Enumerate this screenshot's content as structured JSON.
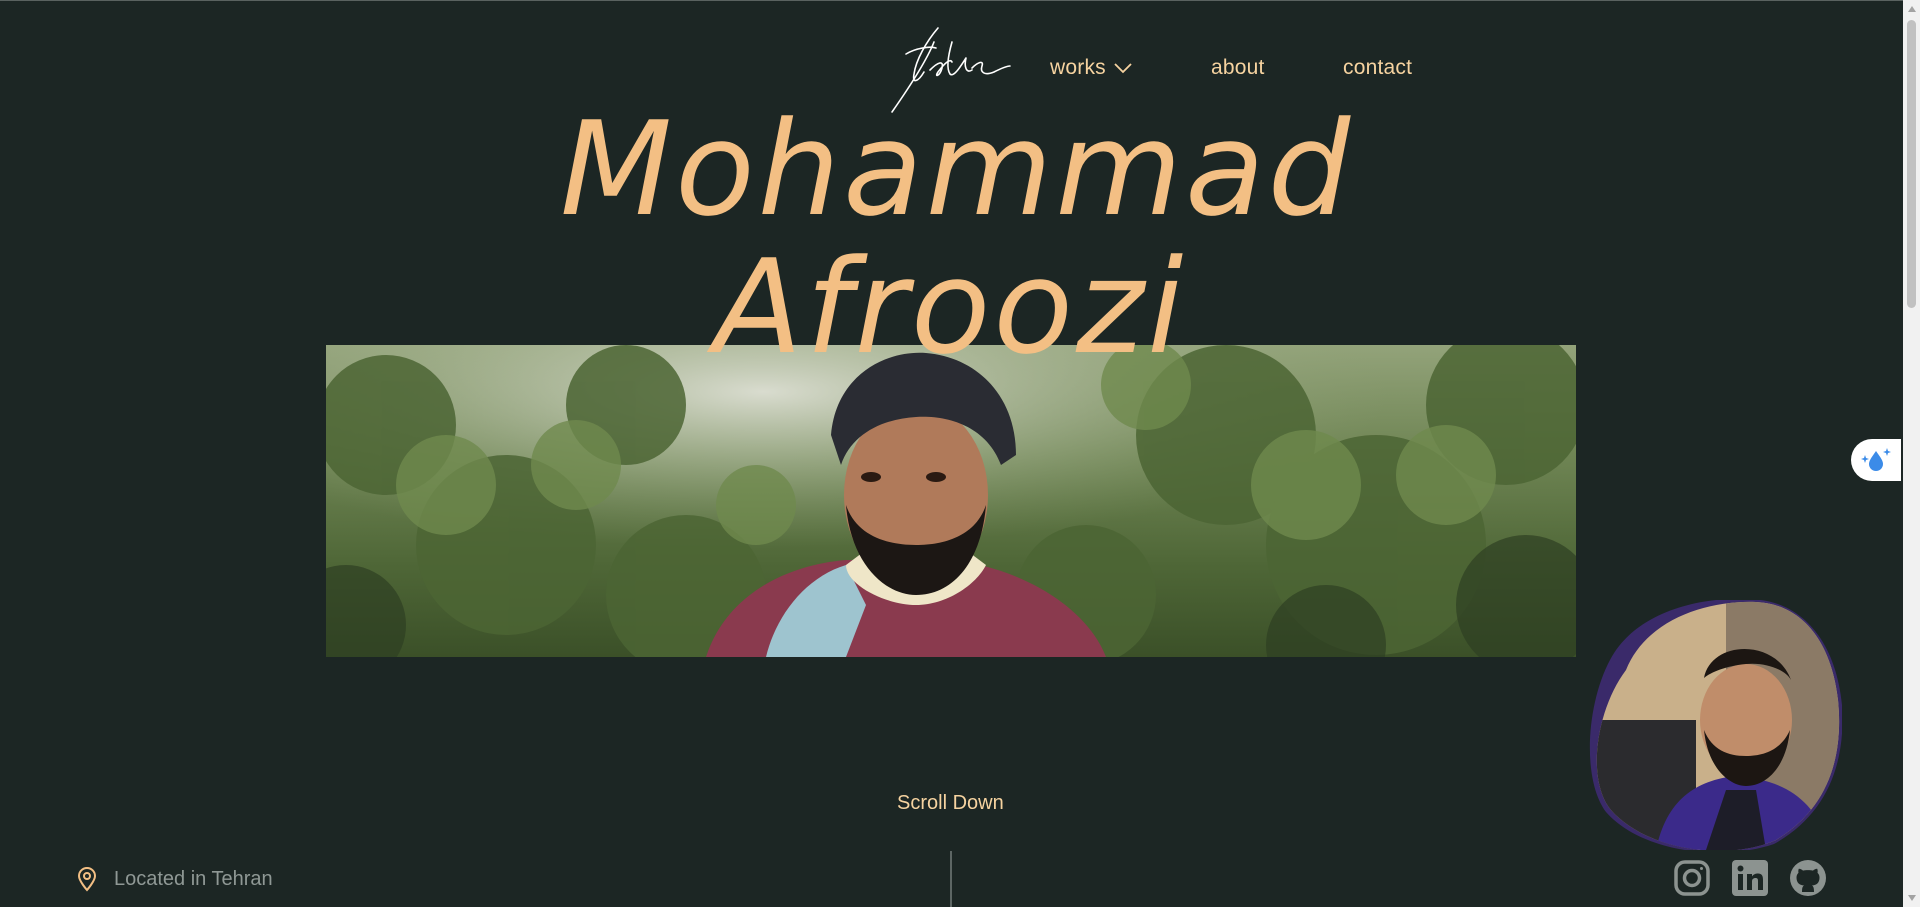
{
  "nav": {
    "items": [
      {
        "label": "works",
        "has_dropdown": true
      },
      {
        "label": "about"
      },
      {
        "label": "contact"
      }
    ]
  },
  "hero": {
    "title_line1": "Mohammad",
    "title_line2": "Afroozi"
  },
  "scroll_hint": "Scroll Down",
  "location": {
    "icon": "map-pin-icon",
    "text": "Located in Tehran"
  },
  "socials": [
    {
      "name": "instagram",
      "icon": "instagram-icon"
    },
    {
      "name": "linkedin",
      "icon": "linkedin-icon"
    },
    {
      "name": "github",
      "icon": "github-icon"
    }
  ],
  "colors": {
    "background": "#1c2624",
    "accent": "#f3bf84",
    "nav_text": "#f6d3a0",
    "muted_text": "#8f9895"
  }
}
